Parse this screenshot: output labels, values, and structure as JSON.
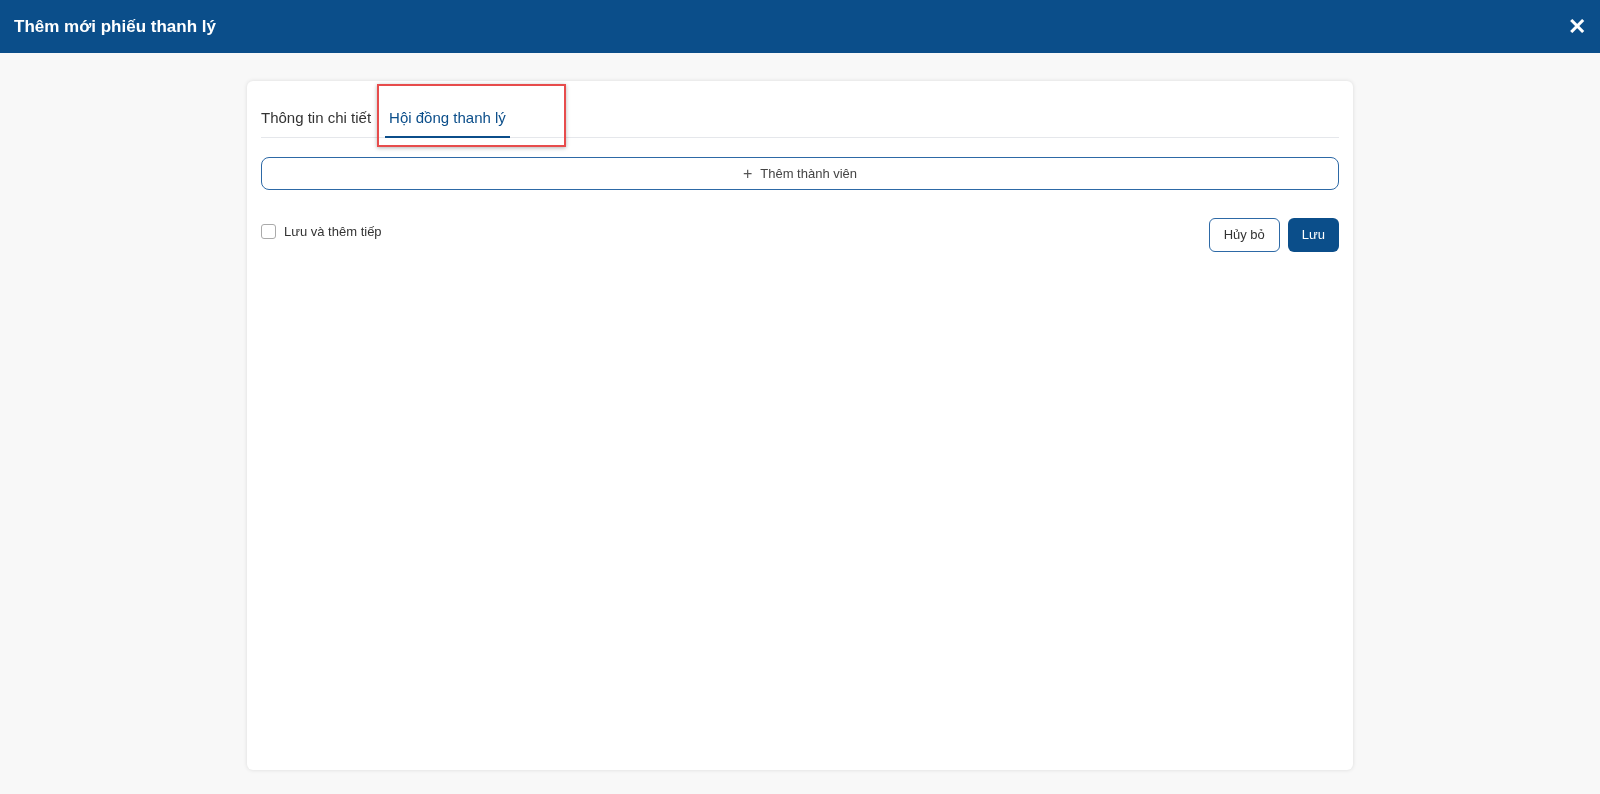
{
  "window": {
    "title": "Thêm mới phiếu thanh lý",
    "close_icon": "✕"
  },
  "tabs": [
    {
      "label": "Thông tin chi tiết",
      "selected": false
    },
    {
      "label": "Hội đồng thanh lý",
      "selected": true
    }
  ],
  "highlight": {
    "on": true
  },
  "add_member_button": {
    "icon": "+",
    "label": "Thêm thành viên"
  },
  "save_and_continue": {
    "label": "Lưu và thêm tiếp",
    "checked": false
  },
  "buttons": [
    {
      "label": "Hủy bỏ",
      "kind": "secondary"
    },
    {
      "label": "Lưu",
      "kind": "primary"
    }
  ]
}
